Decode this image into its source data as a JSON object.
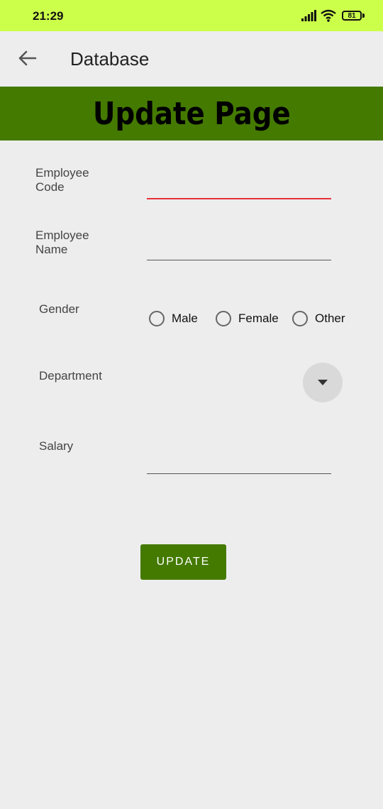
{
  "status_bar": {
    "time": "21:29",
    "battery": "81",
    "icons": [
      "signal-icon",
      "wifi-icon",
      "battery-icon"
    ],
    "background": "#ccff4a"
  },
  "app_bar": {
    "title": "Database",
    "back_icon": "arrow-left-icon"
  },
  "banner": {
    "text": "Update Page",
    "background": "#447a00"
  },
  "form": {
    "employee_code": {
      "label": "Employee\nCode",
      "value": ""
    },
    "employee_name": {
      "label": "Employee\nName",
      "value": ""
    },
    "gender": {
      "label": "Gender",
      "options": [
        "Male",
        "Female",
        "Other"
      ],
      "selected": null
    },
    "department": {
      "label": "Department",
      "dropdown_icon": "caret-down-icon"
    },
    "salary": {
      "label": "Salary",
      "value": ""
    }
  },
  "actions": {
    "update_label": "UPDATE",
    "accent": "#447a00",
    "error_underline": "#e8303c"
  }
}
